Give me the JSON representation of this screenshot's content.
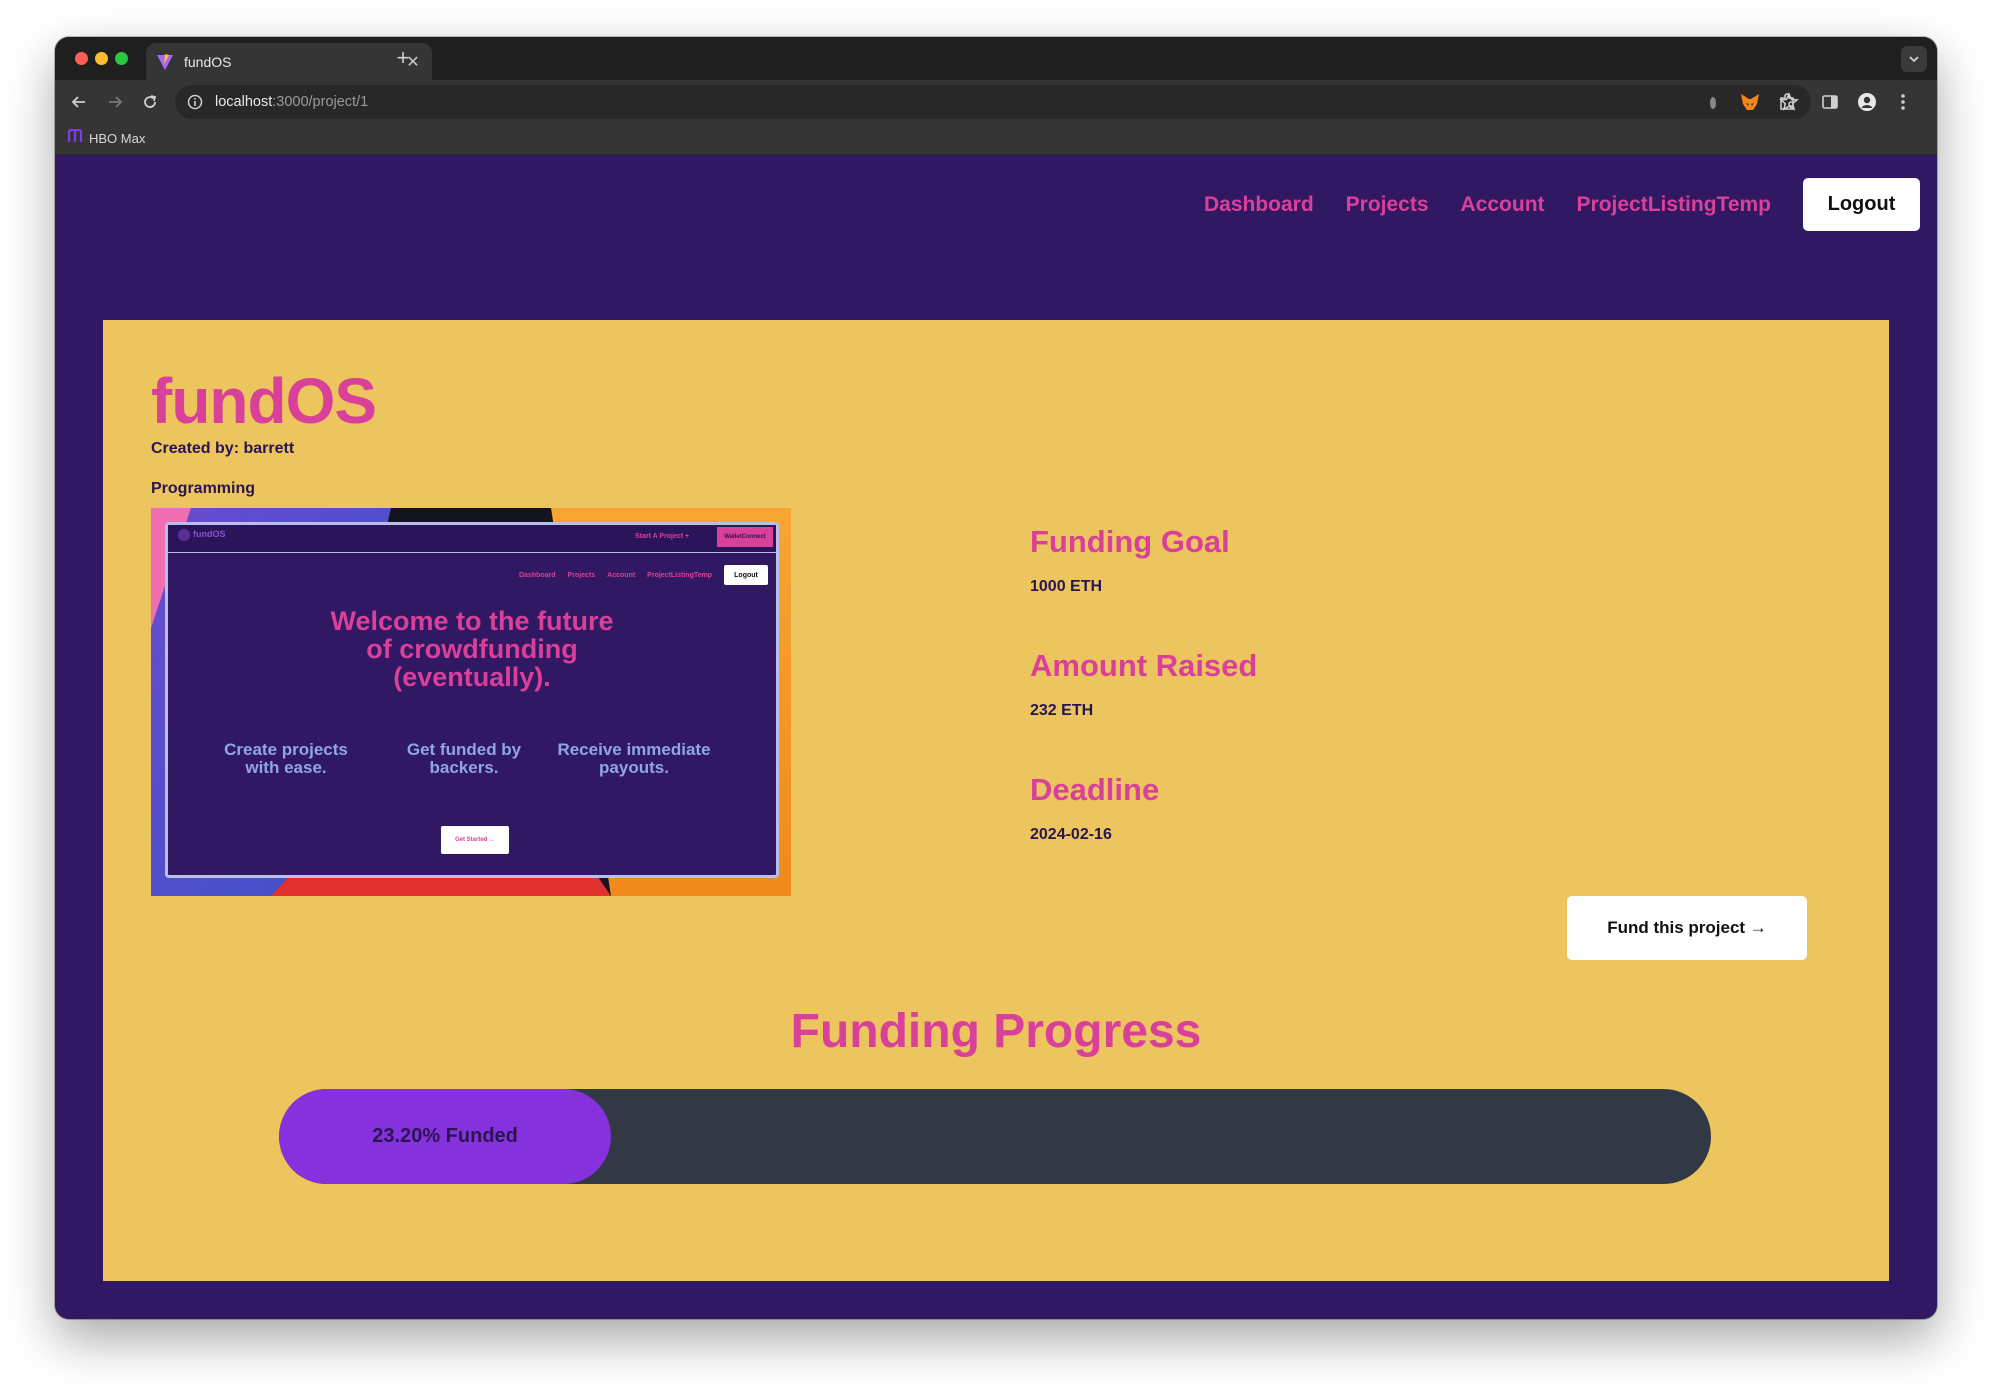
{
  "browser": {
    "tab_title": "fundOS",
    "url_host": "localhost",
    "url_path": ":3000/project/1",
    "bookmark_label": "HBO Max"
  },
  "nav": {
    "links": [
      "Dashboard",
      "Projects",
      "Account",
      "ProjectListingTemp"
    ],
    "logout_label": "Logout"
  },
  "project": {
    "title": "fundOS",
    "created_by": "Created by: barrett",
    "category": "Programming",
    "thumbnail": {
      "brand": "fundOS",
      "start_project": "Start A Project +",
      "wallet_label": "WalletConnect",
      "nav_links": [
        "Dashboard",
        "Projects",
        "Account",
        "ProjectListingTemp"
      ],
      "logout_label": "Logout",
      "headline_lines": [
        "Welcome to the future",
        "of crowdfunding",
        "(eventually)."
      ],
      "features": [
        [
          "Create projects",
          "with ease."
        ],
        [
          "Get funded by",
          "backers."
        ],
        [
          "Receive immediate",
          "payouts."
        ]
      ],
      "cta_label": "Get Started →"
    },
    "stats": [
      {
        "label": "Funding Goal",
        "value": "1000 ETH"
      },
      {
        "label": "Amount Raised",
        "value": "232 ETH"
      },
      {
        "label": "Deadline",
        "value": "2024-02-16"
      }
    ],
    "fund_button_label": "Fund this project →",
    "progress_title": "Funding Progress",
    "progress_text": "23.20% Funded",
    "progress_fraction": 0.232
  },
  "colors": {
    "page_bg": "#311863",
    "card_bg": "#ecc55e",
    "accent_pink": "#d9409a",
    "progress_fill": "#8631de",
    "progress_track": "#333845"
  }
}
